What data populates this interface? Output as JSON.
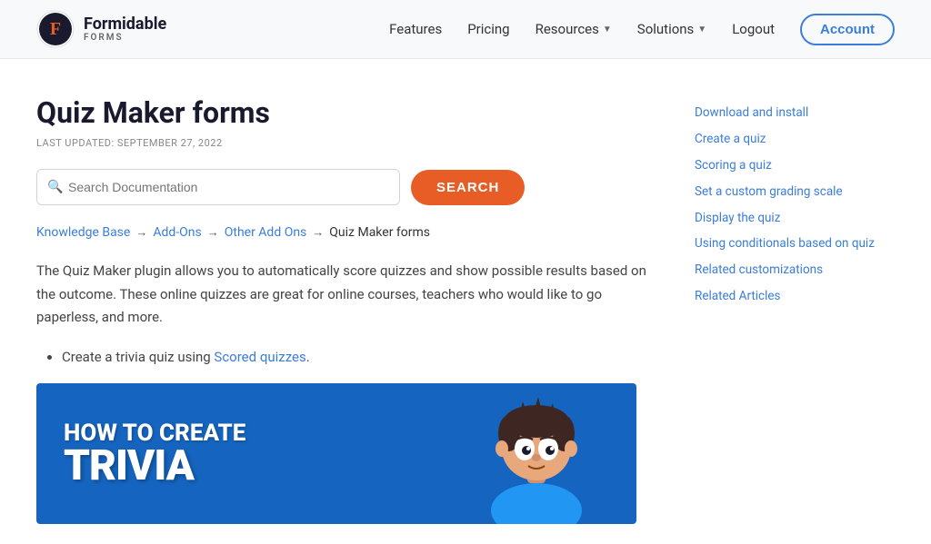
{
  "header": {
    "logo_text": "Formidable",
    "logo_sub": "FORMS",
    "nav": {
      "features_label": "Features",
      "pricing_label": "Pricing",
      "resources_label": "Resources",
      "solutions_label": "Solutions",
      "logout_label": "Logout",
      "account_label": "Account"
    }
  },
  "page": {
    "title": "Quiz Maker forms",
    "last_updated": "LAST UPDATED: SEPTEMBER 27, 2022"
  },
  "search": {
    "placeholder": "Search Documentation",
    "button_label": "SEARCH"
  },
  "breadcrumb": {
    "items": [
      {
        "label": "Knowledge Base",
        "arrow": true
      },
      {
        "label": "Add-Ons",
        "arrow": true
      },
      {
        "label": "Other Add Ons",
        "arrow": true
      },
      {
        "label": "Quiz Maker forms",
        "arrow": false
      }
    ]
  },
  "article": {
    "intro": "The Quiz Maker plugin allows you to automatically score quizzes and show possible results based on the outcome. These online quizzes are great for online courses, teachers who would like to go paperless, and more.",
    "list_item": "Create a trivia quiz using",
    "list_link": "Scored quizzes",
    "image_line1": "HOW TO CREATE",
    "image_line2": "TRIVIA"
  },
  "sidebar": {
    "links": [
      "Download and install",
      "Create a quiz",
      "Scoring a quiz",
      "Set a custom grading scale",
      "Display the quiz",
      "Using conditionals based on quiz",
      "Related customizations",
      "Related Articles"
    ]
  }
}
